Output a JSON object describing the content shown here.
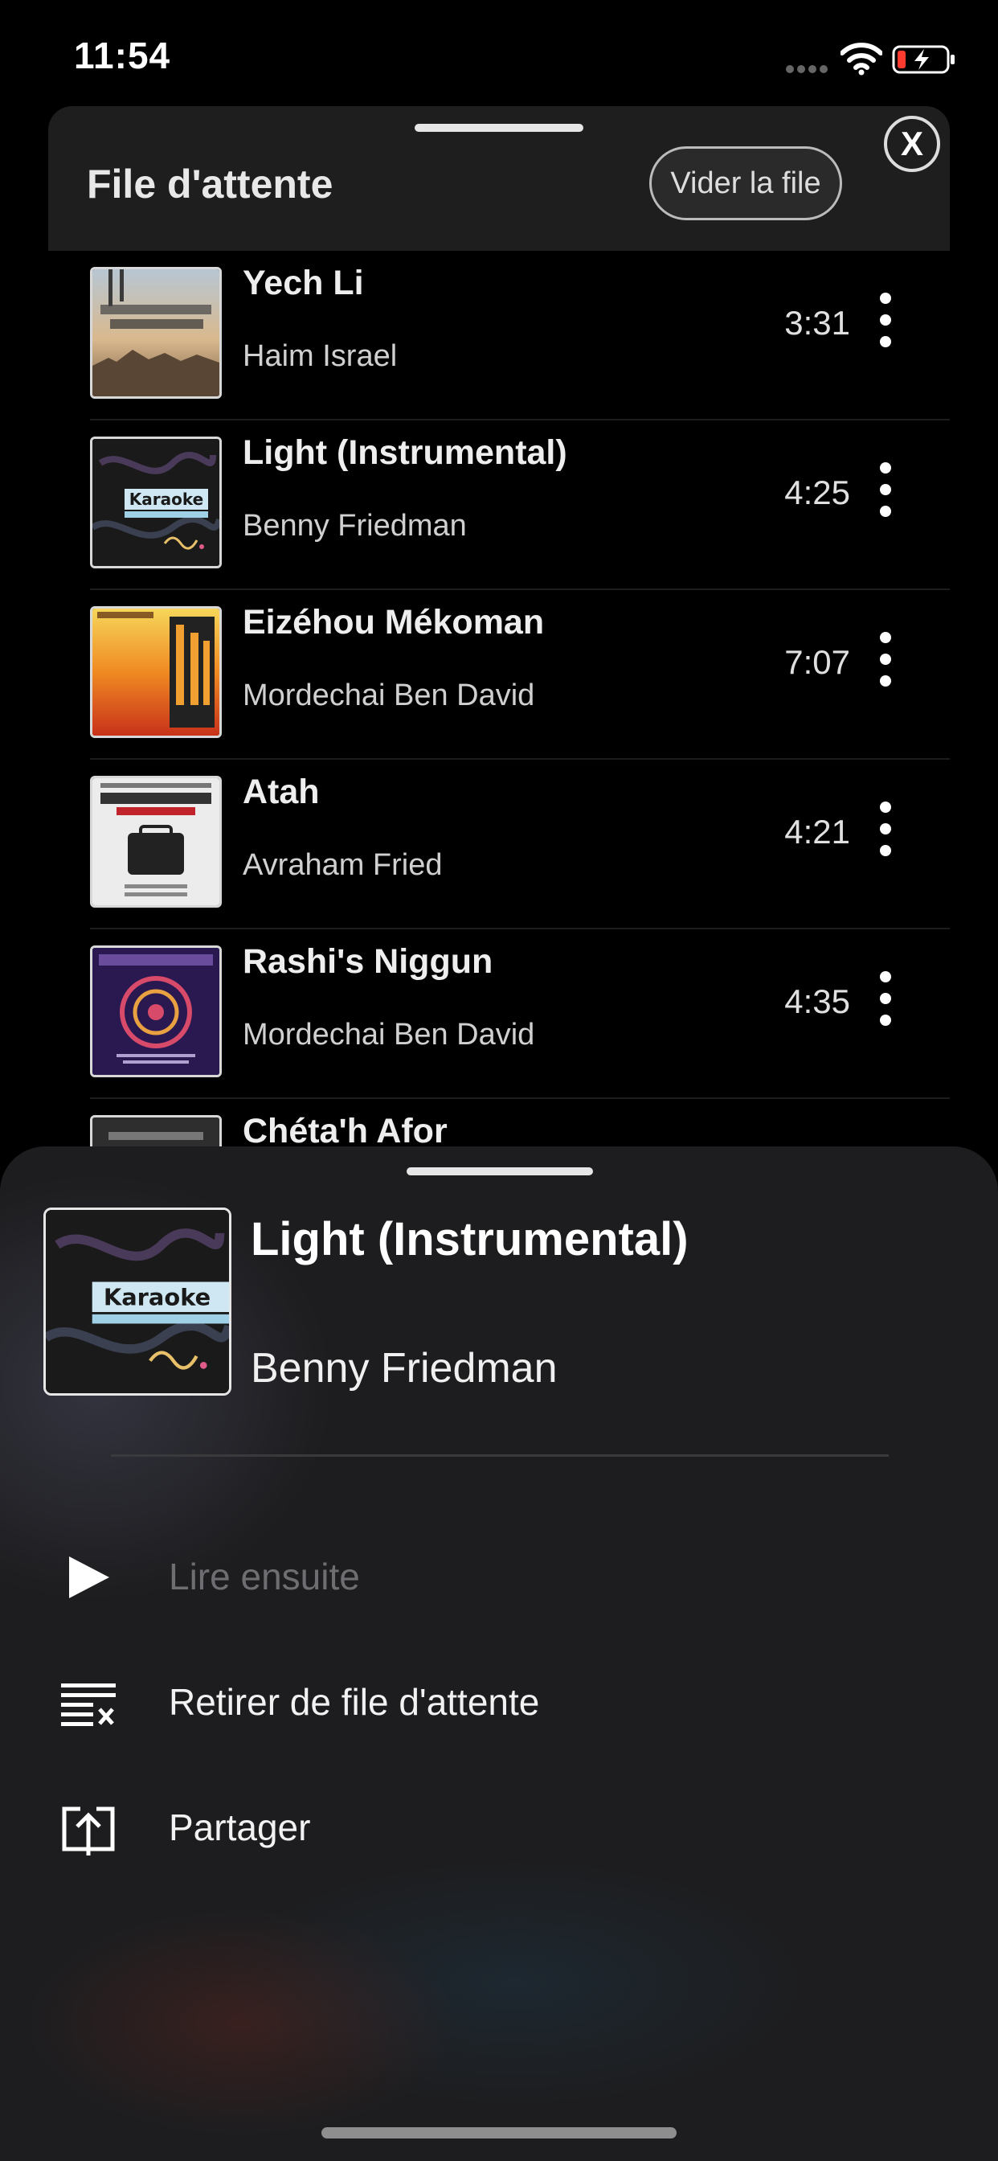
{
  "status_bar": {
    "time": "11:54"
  },
  "queue": {
    "title": "File d'attente",
    "clear_label": "Vider la file",
    "close_label": "X",
    "tracks": [
      {
        "title": "Yech Li",
        "artist": "Haim Israel",
        "duration": "3:31"
      },
      {
        "title": "Light (Instrumental)",
        "artist": "Benny Friedman",
        "duration": "4:25"
      },
      {
        "title": "Eizéhou Mékoman",
        "artist": "Mordechai Ben David",
        "duration": "7:07"
      },
      {
        "title": "Atah",
        "artist": "Avraham Fried",
        "duration": "4:21"
      },
      {
        "title": "Rashi's Niggun",
        "artist": "Mordechai Ben David",
        "duration": "4:35"
      },
      {
        "title": "Chéta'h Afor",
        "artist": "",
        "duration": ""
      }
    ]
  },
  "action_sheet": {
    "title": "Light (Instrumental)",
    "artist": "Benny Friedman",
    "items": [
      {
        "label": "Lire ensuite",
        "icon": "play-icon",
        "enabled": false
      },
      {
        "label": "Retirer de file d'attente",
        "icon": "remove-from-queue-icon",
        "enabled": true
      },
      {
        "label": "Partager",
        "icon": "share-icon",
        "enabled": true
      }
    ]
  },
  "colors": {
    "background": "#000000",
    "sheet": "#1d1d1f",
    "header": "#1e1e1e",
    "disabled_text": "#6e6e72"
  }
}
